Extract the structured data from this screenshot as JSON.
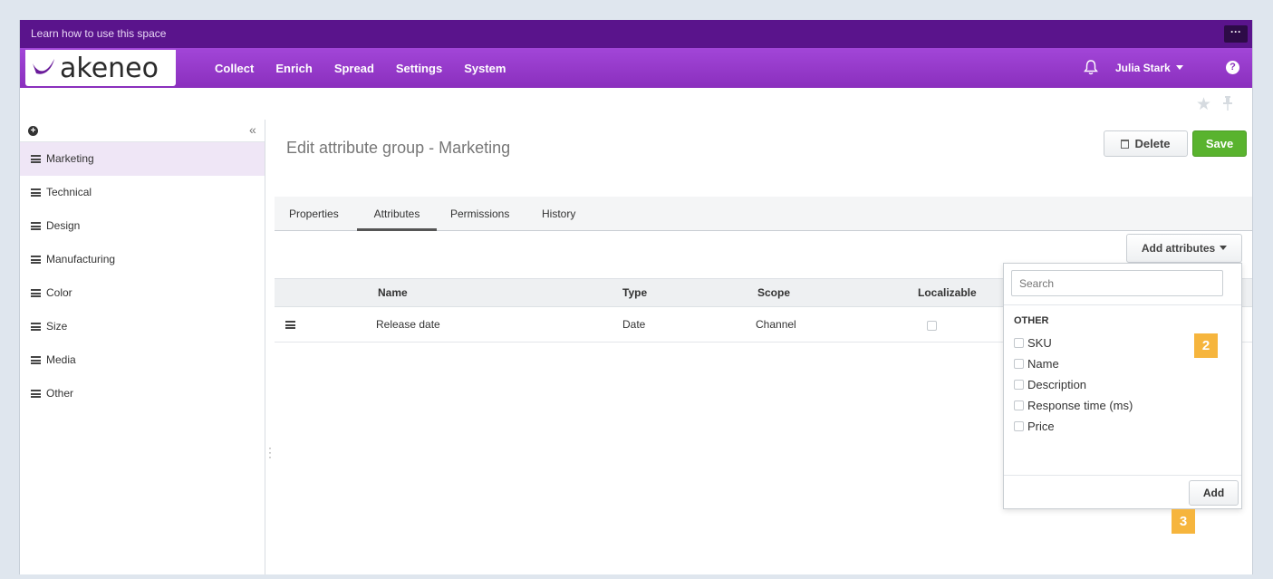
{
  "banner": {
    "text": "Learn how to use this space",
    "more": "···"
  },
  "brand": {
    "name": "akeneo"
  },
  "nav": {
    "items": [
      "Collect",
      "Enrich",
      "Spread",
      "Settings",
      "System"
    ]
  },
  "user": {
    "name": "Julia Stark",
    "help": "?"
  },
  "sidebar": {
    "items": [
      {
        "label": "Marketing"
      },
      {
        "label": "Technical"
      },
      {
        "label": "Design"
      },
      {
        "label": "Manufacturing"
      },
      {
        "label": "Color"
      },
      {
        "label": "Size"
      },
      {
        "label": "Media"
      },
      {
        "label": "Other"
      }
    ]
  },
  "page": {
    "title": "Edit attribute group - Marketing",
    "delete_label": "Delete",
    "save_label": "Save"
  },
  "tabs": [
    "Properties",
    "Attributes",
    "Permissions",
    "History"
  ],
  "attributes": {
    "add_button": "Add attributes",
    "columns": [
      "Name",
      "Type",
      "Scope",
      "Localizable"
    ],
    "rows": [
      {
        "name": "Release date",
        "type": "Date",
        "scope": "Channel"
      }
    ]
  },
  "dropdown": {
    "search_placeholder": "Search",
    "group": "OTHER",
    "options": [
      "SKU",
      "Name",
      "Description",
      "Response time (ms)",
      "Price"
    ],
    "add_label": "Add"
  },
  "callouts": {
    "two": "2",
    "three": "3"
  },
  "colors": {
    "banner": "#5a148c",
    "nav": "#9a3dd0",
    "save": "#59b32e",
    "callout": "#f6b53d"
  }
}
